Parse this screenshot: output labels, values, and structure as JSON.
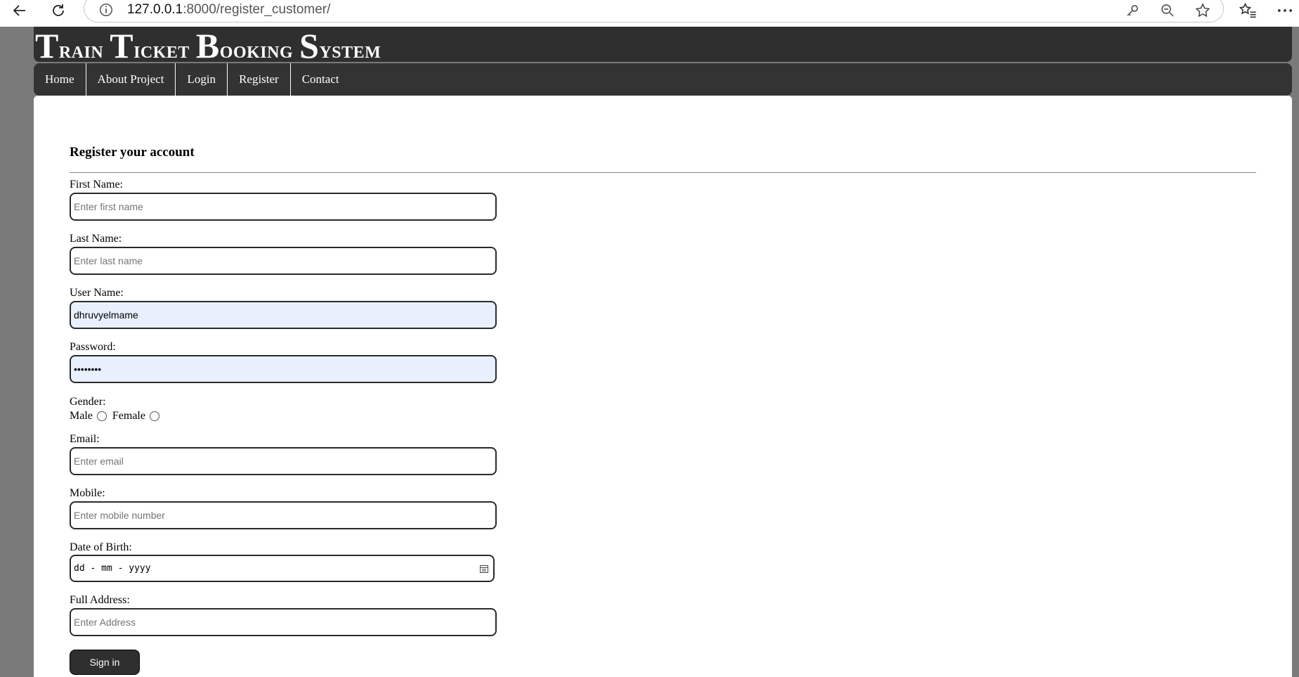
{
  "browser": {
    "url_host": "127.0.0.1",
    "url_rest": ":8000/register_customer/"
  },
  "site": {
    "title_parts": [
      {
        "text": "T",
        "big": true
      },
      {
        "text": "rain ",
        "big": false
      },
      {
        "text": "T",
        "big": true
      },
      {
        "text": "icket ",
        "big": false
      },
      {
        "text": "B",
        "big": true
      },
      {
        "text": "ooking ",
        "big": false
      },
      {
        "text": "S",
        "big": true
      },
      {
        "text": "ystem",
        "big": false
      }
    ]
  },
  "menu": {
    "home": "Home",
    "about": "About Project",
    "login": "Login",
    "register": "Register",
    "contact": "Contact"
  },
  "form": {
    "title": "Register your account",
    "first_name": {
      "label": "First Name:",
      "placeholder": "Enter first name",
      "value": ""
    },
    "last_name": {
      "label": "Last Name:",
      "placeholder": "Enter last name",
      "value": ""
    },
    "user_name": {
      "label": "User Name:",
      "placeholder": "",
      "value": "dhruvyelmame"
    },
    "password": {
      "label": "Password:",
      "value": "••••••••"
    },
    "gender": {
      "label": "Gender:",
      "male": "Male",
      "female": "Female"
    },
    "email": {
      "label": "Email:",
      "placeholder": "Enter email",
      "value": ""
    },
    "mobile": {
      "label": "Mobile:",
      "placeholder": "Enter mobile number",
      "value": ""
    },
    "dob": {
      "label": "Date of Birth:",
      "placeholder": "dd - mm - yyyy"
    },
    "address": {
      "label": "Full Address:",
      "placeholder": "Enter Address",
      "value": ""
    },
    "submit": "Sign in"
  },
  "colors": {
    "header_bg": "#2f2f2f",
    "side_bg": "#7a7a7a",
    "autofill_bg": "#e8f0fe"
  }
}
